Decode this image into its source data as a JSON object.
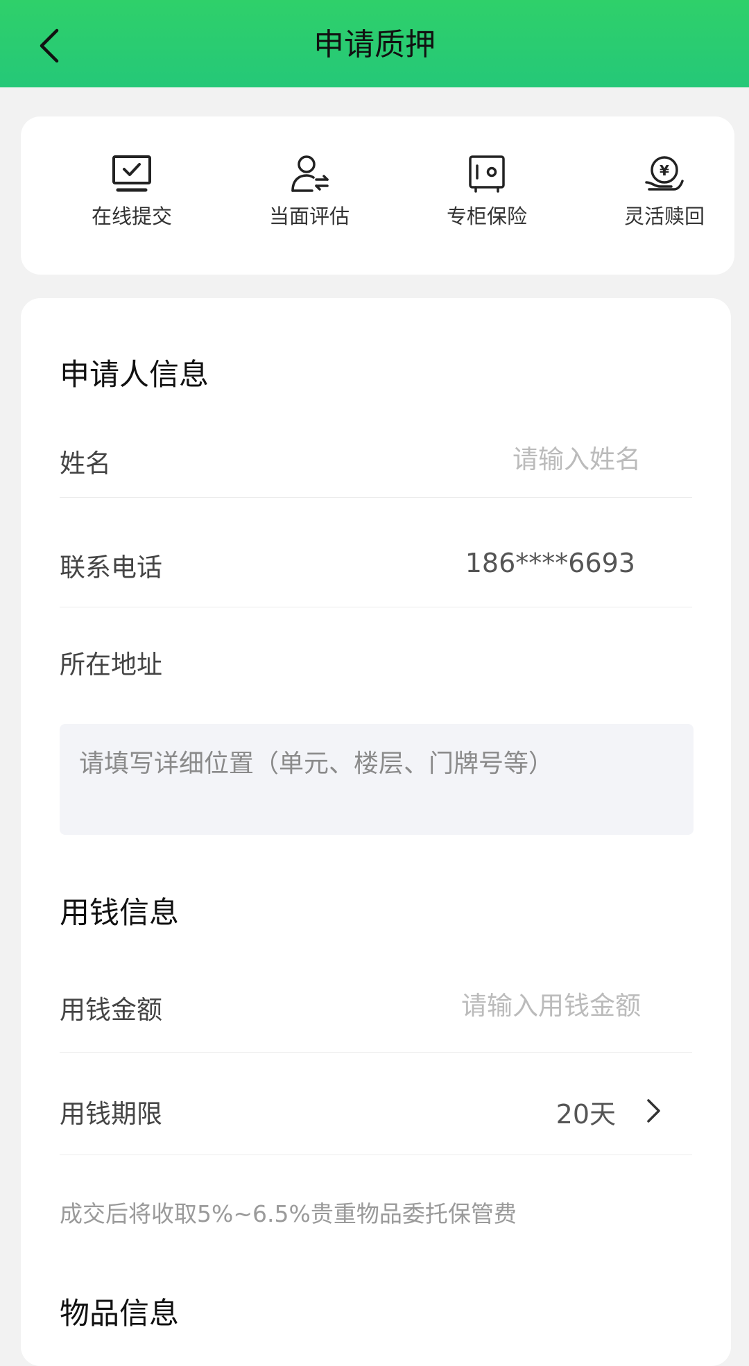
{
  "header": {
    "title": "申请质押",
    "back_icon": "chevron-left-icon"
  },
  "features": [
    {
      "label": "在线提交",
      "icon": "monitor-check-icon"
    },
    {
      "label": "当面评估",
      "icon": "person-transfer-icon"
    },
    {
      "label": "专柜保险",
      "icon": "safe-icon"
    },
    {
      "label": "灵活赎回",
      "icon": "yen-hand-icon"
    }
  ],
  "applicant": {
    "section_title": "申请人信息",
    "name_label": "姓名",
    "name_placeholder": "请输入姓名",
    "phone_label": "联系电话",
    "phone_value": "186****6693",
    "address_label": "所在地址",
    "address_placeholder": "请填写详细位置（单元、楼层、门牌号等）"
  },
  "money": {
    "section_title": "用钱信息",
    "amount_label": "用钱金额",
    "amount_placeholder": "请输入用钱金额",
    "period_label": "用钱期限",
    "period_value": "20天",
    "fee_note": "成交后将收取5%~6.5%贵重物品委托保管费"
  },
  "item": {
    "section_title": "物品信息"
  },
  "colors": {
    "header_top": "#2fd06a",
    "header_bottom": "#25c878",
    "background": "#f2f2f2",
    "card": "#ffffff",
    "placeholder": "#bbbbbb",
    "address_bg": "#f3f4f8"
  }
}
